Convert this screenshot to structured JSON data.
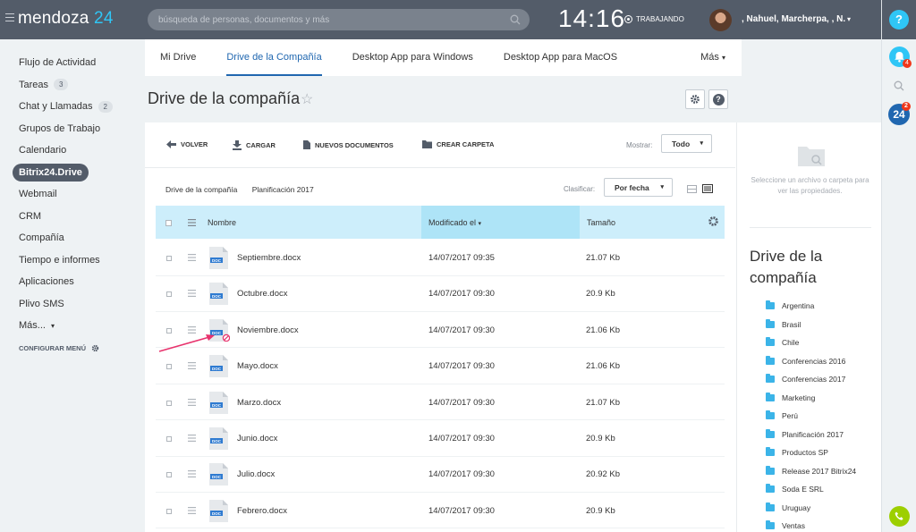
{
  "header": {
    "logo_name": "mendoza",
    "logo_number": "24",
    "search_placeholder": "búsqueda de personas, documentos y más",
    "clock": "14:16",
    "work_status": "TRABAJANDO",
    "user_name": ", Nahuel, Marcherpa, , N."
  },
  "rightbar": {
    "help": "?",
    "notifications_count": "4",
    "b24_label": "24",
    "b24_count": "2"
  },
  "sidebar": {
    "items": [
      {
        "label": "Flujo de Actividad",
        "count": ""
      },
      {
        "label": "Tareas",
        "count": "3"
      },
      {
        "label": "Chat y Llamadas",
        "count": "2"
      },
      {
        "label": "Grupos de Trabajo",
        "count": ""
      },
      {
        "label": "Calendario",
        "count": ""
      },
      {
        "label": "Bitrix24.Drive",
        "count": ""
      },
      {
        "label": "Webmail",
        "count": ""
      },
      {
        "label": "CRM",
        "count": ""
      },
      {
        "label": "Compañía",
        "count": ""
      },
      {
        "label": "Tiempo e informes",
        "count": ""
      },
      {
        "label": "Aplicaciones",
        "count": ""
      },
      {
        "label": "Plivo SMS",
        "count": ""
      },
      {
        "label": "Más...",
        "count": ""
      }
    ],
    "configure": "CONFIGURAR MENÚ"
  },
  "tabs": [
    "Mi Drive",
    "Drive de la Compañía",
    "Desktop App para Windows",
    "Desktop App para MacOS"
  ],
  "tab_more": "Más",
  "page_title": "Drive de la compañía",
  "toolbar": {
    "back": "VOLVER",
    "upload": "CARGAR",
    "new_docs": "NUEVOS DOCUMENTOS",
    "new_folder": "CREAR CARPETA",
    "show_label": "Mostrar:",
    "show_value": "Todo"
  },
  "breadcrumb": [
    "Drive de la compañía",
    "Planificación 2017"
  ],
  "sort": {
    "label": "Clasificar:",
    "value": "Por fecha"
  },
  "table": {
    "columns": {
      "name": "Nombre",
      "modified": "Modificado el",
      "size": "Tamaño"
    },
    "rows": [
      {
        "name": "Septiembre.docx",
        "date": "14/07/2017 09:35",
        "size": "21.07 Kb"
      },
      {
        "name": "Octubre.docx",
        "date": "14/07/2017 09:30",
        "size": "20.9 Kb"
      },
      {
        "name": "Noviembre.docx",
        "date": "14/07/2017 09:30",
        "size": "21.06 Kb"
      },
      {
        "name": "Mayo.docx",
        "date": "14/07/2017 09:30",
        "size": "21.06 Kb"
      },
      {
        "name": "Marzo.docx",
        "date": "14/07/2017 09:30",
        "size": "21.07 Kb"
      },
      {
        "name": "Junio.docx",
        "date": "14/07/2017 09:30",
        "size": "20.9 Kb"
      },
      {
        "name": "Julio.docx",
        "date": "14/07/2017 09:30",
        "size": "20.92 Kb"
      },
      {
        "name": "Febrero.docx",
        "date": "14/07/2017 09:30",
        "size": "20.9 Kb"
      }
    ],
    "doc_icon_text": "DOC"
  },
  "right_panel": {
    "hint": "Seleccione un archivo o carpeta para ver las propiedades.",
    "title": "Drive de la compañía",
    "folders": [
      "Argentina",
      "Brasil",
      "Chile",
      "Conferencias 2016",
      "Conferencias 2017",
      "Marketing",
      "Perú",
      "Planificación 2017",
      "Productos SP",
      "Release 2017 Bitrix24",
      "Soda E SRL",
      "Uruguay",
      "Ventas"
    ]
  },
  "colors": {
    "accent": "#2067b0",
    "header": "#535c69",
    "table_head": "#cdeefb",
    "arrow": "#e8336d"
  }
}
